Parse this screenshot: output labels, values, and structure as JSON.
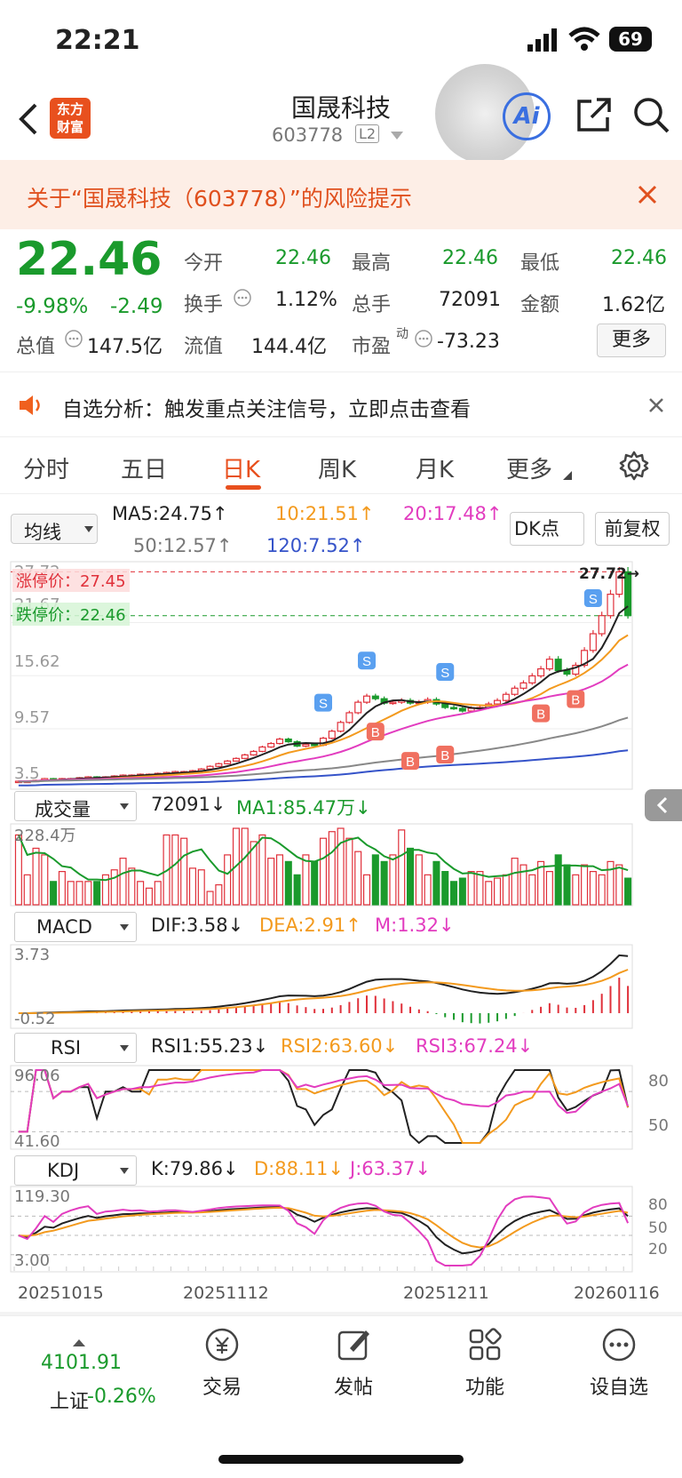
{
  "status": {
    "time": "22:21",
    "battery": "69"
  },
  "header": {
    "back_icon": "chevron-left-icon",
    "logo_line1": "东方",
    "logo_line2": "财富",
    "title": "国晟科技",
    "code": "603778",
    "level": "L2",
    "ai_label": "Ai"
  },
  "banner": {
    "text": "关于“国晟科技（603778）”的风险提示"
  },
  "quote": {
    "price": "22.46",
    "change_pct": "-9.98%",
    "change": "-2.49",
    "open_label": "今开",
    "open": "22.46",
    "high_label": "最高",
    "high": "22.46",
    "low_label": "最低",
    "low": "22.46",
    "turnover_label": "换手",
    "turnover": "1.12%",
    "volume_label": "总手",
    "volume": "72091",
    "amount_label": "金额",
    "amount": "1.62亿",
    "mcap_label": "总值",
    "mcap": "147.5亿",
    "float_label": "流值",
    "float": "144.4亿",
    "pe_label": "市盈",
    "pe_sup": "动",
    "pe": "-73.23",
    "more": "更多"
  },
  "notice": {
    "text": "自选分析：触发重点关注信号，立即点击查看"
  },
  "tabs": [
    "分时",
    "五日",
    "日K",
    "周K",
    "月K",
    "更多"
  ],
  "active_tab": "日K",
  "ma": {
    "selector": "均线",
    "ma5": "MA5:24.75↑",
    "ma10": "10:21.51↑",
    "ma20": "20:17.48↑",
    "ma50": "50:12.57↑",
    "ma120": "120:7.52↑",
    "dk": "DK点",
    "fq": "前复权"
  },
  "kline": {
    "limit_up": "涨停价：27.45",
    "limit_down": "跌停价：22.46",
    "y_labels": [
      "27.72",
      "21.67",
      "15.62",
      "9.57",
      "3.5"
    ],
    "max_label": "27.72→",
    "markers": {
      "b": "B",
      "s": "S"
    }
  },
  "vol": {
    "selector": "成交量",
    "value": "72091↓",
    "ma1": "MA1:85.47万↓",
    "ymax": "228.4万"
  },
  "macd": {
    "selector": "MACD",
    "dif": "DIF:3.58↓",
    "dea": "DEA:2.91↑",
    "m": "M:1.32↓",
    "ymax": "3.73",
    "ymin": "-0.52"
  },
  "rsi": {
    "selector": "RSI",
    "rsi1": "RSI1:55.23↓",
    "rsi2": "RSI2:63.60↓",
    "rsi3": "RSI3:67.24↓",
    "ymax": "96.06",
    "ymin": "41.60",
    "r80": "80",
    "r50": "50"
  },
  "kdj": {
    "selector": "KDJ",
    "k": "K:79.86↓",
    "d": "D:88.11↓",
    "j": "J:63.37↓",
    "ymax": "119.30",
    "ymin": "3.00",
    "l80": "80",
    "l50": "50",
    "l20": "20"
  },
  "dates": [
    "20251015",
    "20251112",
    "20251211",
    "20260116"
  ],
  "bottom": {
    "index_value": "4101.91",
    "index_name": "上证",
    "index_change": "-0.26%",
    "trade": "交易",
    "post": "发帖",
    "func": "功能",
    "watch": "设自选"
  },
  "colors": {
    "up": "#e0303a",
    "down": "#1a9a2c",
    "ma5": "#222222",
    "ma10": "#f39a1e",
    "ma20": "#e23cbf",
    "ma50": "#888888",
    "ma120": "#3553c9"
  },
  "chart_data": {
    "type": "candlestick",
    "close": [
      3.6,
      3.6,
      3.7,
      3.9,
      3.8,
      3.9,
      3.9,
      4.0,
      4.1,
      4.0,
      4.1,
      4.2,
      4.3,
      4.3,
      4.4,
      4.4,
      4.5,
      4.6,
      4.7,
      4.7,
      4.8,
      5.0,
      5.3,
      5.6,
      5.9,
      6.2,
      6.6,
      7.0,
      7.5,
      7.9,
      8.4,
      8.1,
      7.6,
      7.8,
      7.7,
      8.5,
      9.3,
      10.3,
      11.4,
      12.6,
      13.3,
      13.0,
      12.5,
      12.6,
      12.8,
      12.5,
      12.6,
      12.9,
      12.4,
      12.0,
      11.9,
      11.6,
      11.9,
      12.0,
      12.4,
      12.8,
      13.5,
      14.2,
      14.8,
      15.6,
      16.4,
      17.5,
      16.2,
      15.8,
      16.8,
      18.5,
      20.4,
      22.46,
      24.9,
      27.45,
      22.46
    ],
    "volume_wan": [
      210,
      90,
      170,
      150,
      70,
      100,
      70,
      70,
      70,
      70,
      90,
      105,
      140,
      110,
      70,
      50,
      70,
      210,
      210,
      200,
      110,
      105,
      40,
      60,
      150,
      230,
      230,
      190,
      210,
      140,
      150,
      130,
      90,
      150,
      130,
      200,
      220,
      230,
      200,
      160,
      90,
      150,
      130,
      150,
      225,
      170,
      150,
      90,
      130,
      100,
      70,
      80,
      100,
      100,
      70,
      80,
      90,
      140,
      120,
      90,
      130,
      100,
      150,
      120,
      90,
      120,
      100,
      90,
      130,
      120,
      80
    ]
  }
}
